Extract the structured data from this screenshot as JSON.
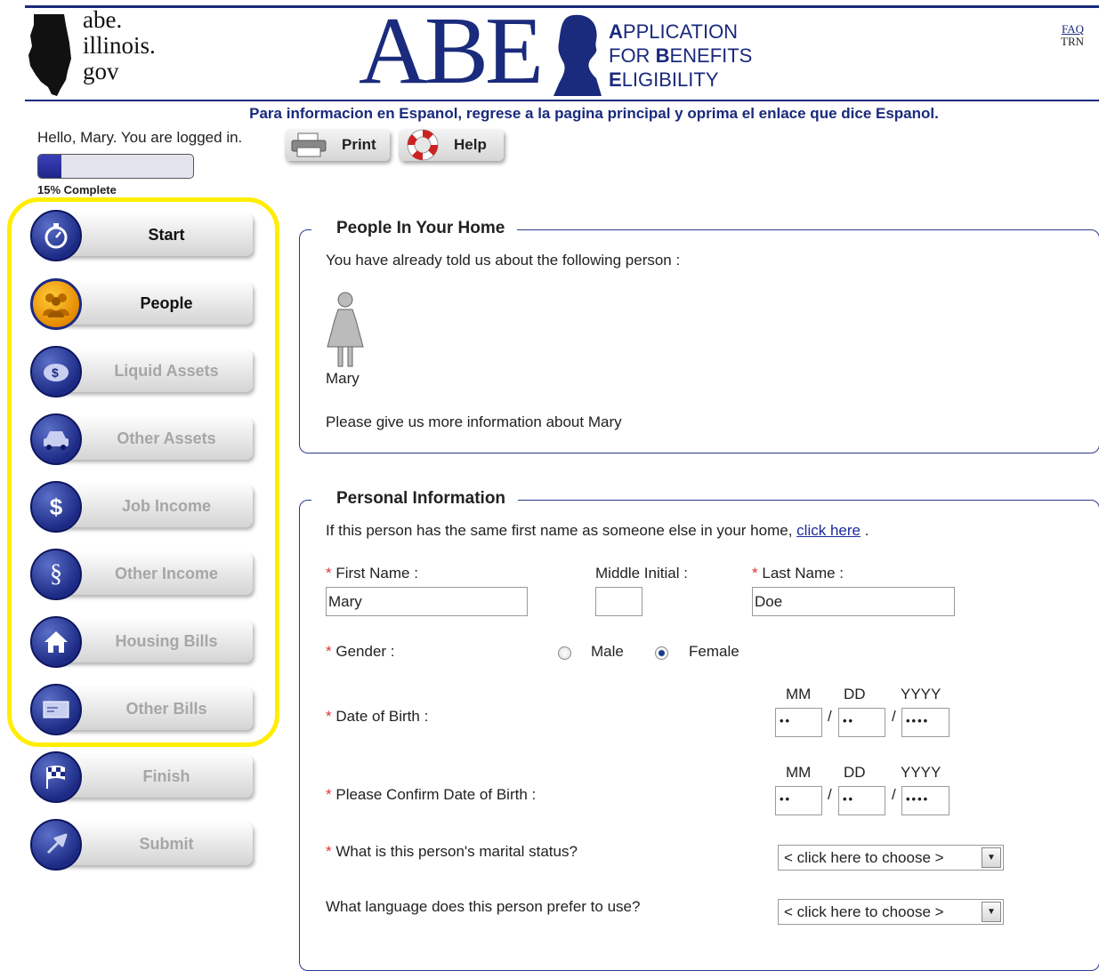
{
  "header": {
    "site_text": [
      "abe.",
      "illinois.",
      "gov"
    ],
    "logo_text": "ABE",
    "app_title": [
      {
        "cap": "A",
        "rest": "PPLICATION"
      },
      {
        "pre": "FOR ",
        "cap": "B",
        "rest": "ENEFITS"
      },
      {
        "cap": "E",
        "rest": "LIGIBILITY"
      }
    ],
    "faq_label": "FAQ",
    "trn_label": "TRN",
    "spanish_notice": "Para informacion en Espanol, regrese a la pagina principal y oprima el enlace que dice Espanol.",
    "brand_color": "#1a2a7c"
  },
  "user": {
    "greeting": "Hello, Mary. You are logged in."
  },
  "toolbar": {
    "print_label": "Print",
    "help_label": "Help"
  },
  "progress": {
    "percent": 15,
    "label": "15% Complete"
  },
  "sidebar": {
    "items": [
      {
        "label": "Start",
        "icon": "stopwatch-icon",
        "state": "active"
      },
      {
        "label": "People",
        "icon": "people-icon",
        "state": "current"
      },
      {
        "label": "Liquid Assets",
        "icon": "piggy-bank-icon",
        "state": "disabled"
      },
      {
        "label": "Other Assets",
        "icon": "car-icon",
        "state": "disabled"
      },
      {
        "label": "Job Income",
        "icon": "dollar-icon",
        "state": "disabled"
      },
      {
        "label": "Other Income",
        "icon": "money-icon",
        "state": "disabled"
      },
      {
        "label": "Housing Bills",
        "icon": "house-icon",
        "state": "disabled"
      },
      {
        "label": "Other Bills",
        "icon": "bill-icon",
        "state": "disabled"
      },
      {
        "label": "Finish",
        "icon": "checkered-flag-icon",
        "state": "disabled"
      },
      {
        "label": "Submit",
        "icon": "arrow-icon",
        "state": "disabled"
      }
    ],
    "highlight_color": "#ffee00"
  },
  "people_section": {
    "legend": "People In Your Home",
    "intro": "You have already told us about the following person :",
    "person_name": "Mary",
    "prompt": "Please give us more information about Mary"
  },
  "personal_info": {
    "legend": "Personal Information",
    "same_name_text": "If this person has the same first name as someone else in your home,",
    "same_name_link": "click here",
    "same_name_end": ".",
    "first_name_label": "First Name :",
    "first_name_value": "Mary",
    "middle_initial_label": "Middle Initial :",
    "middle_initial_value": "",
    "last_name_label": "Last Name :",
    "last_name_value": "Doe",
    "gender_label": "Gender :",
    "gender_options": [
      "Male",
      "Female"
    ],
    "gender_selected": "Female",
    "dob_label": "Date of Birth :",
    "confirm_dob_label": "Please Confirm Date of Birth :",
    "date_headers": [
      "MM",
      "DD",
      "YYYY"
    ],
    "date_separator": "/",
    "dob_values": [
      "••",
      "••",
      "••••"
    ],
    "confirm_dob_values": [
      "••",
      "••",
      "••••"
    ],
    "marital_label": "What is this person's marital status?",
    "marital_value": "< click here to choose >",
    "language_label": "What language does this person prefer to use?",
    "language_value": "< click here to choose >",
    "required_mark": "*"
  }
}
